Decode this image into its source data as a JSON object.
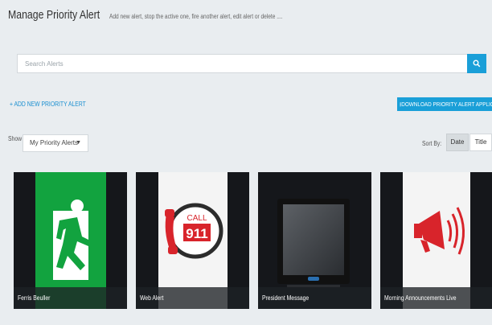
{
  "header": {
    "title": "Manage Priority Alert",
    "subtitle": "Add new alert, stop the active one, fire another alert, edit alert or delete ...."
  },
  "search": {
    "placeholder": "Search Alerts",
    "value": ""
  },
  "actions": {
    "add_link": "+ ADD NEW PRIORITY ALERT",
    "download_button": "DOWNLOAD PRIORITY ALERT APPLICATION"
  },
  "filter": {
    "show_label": "Show",
    "show_selected": "My Priority Alerts"
  },
  "sort": {
    "label": "Sort By:",
    "options": [
      "Date",
      "Title"
    ],
    "active": "Date"
  },
  "alerts": [
    {
      "title": "Ferris Beuller",
      "icon": "exit-sign-icon"
    },
    {
      "title": "Web Alert",
      "icon": "call-911-icon"
    },
    {
      "title": "President Message",
      "icon": "monitor-icon"
    },
    {
      "title": "Morning Announcements Live",
      "icon": "megaphone-icon"
    }
  ],
  "colors": {
    "accent": "#1a9fd8",
    "background": "#e9edf0",
    "exit_green": "#12a33f",
    "alert_red": "#d8242b"
  }
}
